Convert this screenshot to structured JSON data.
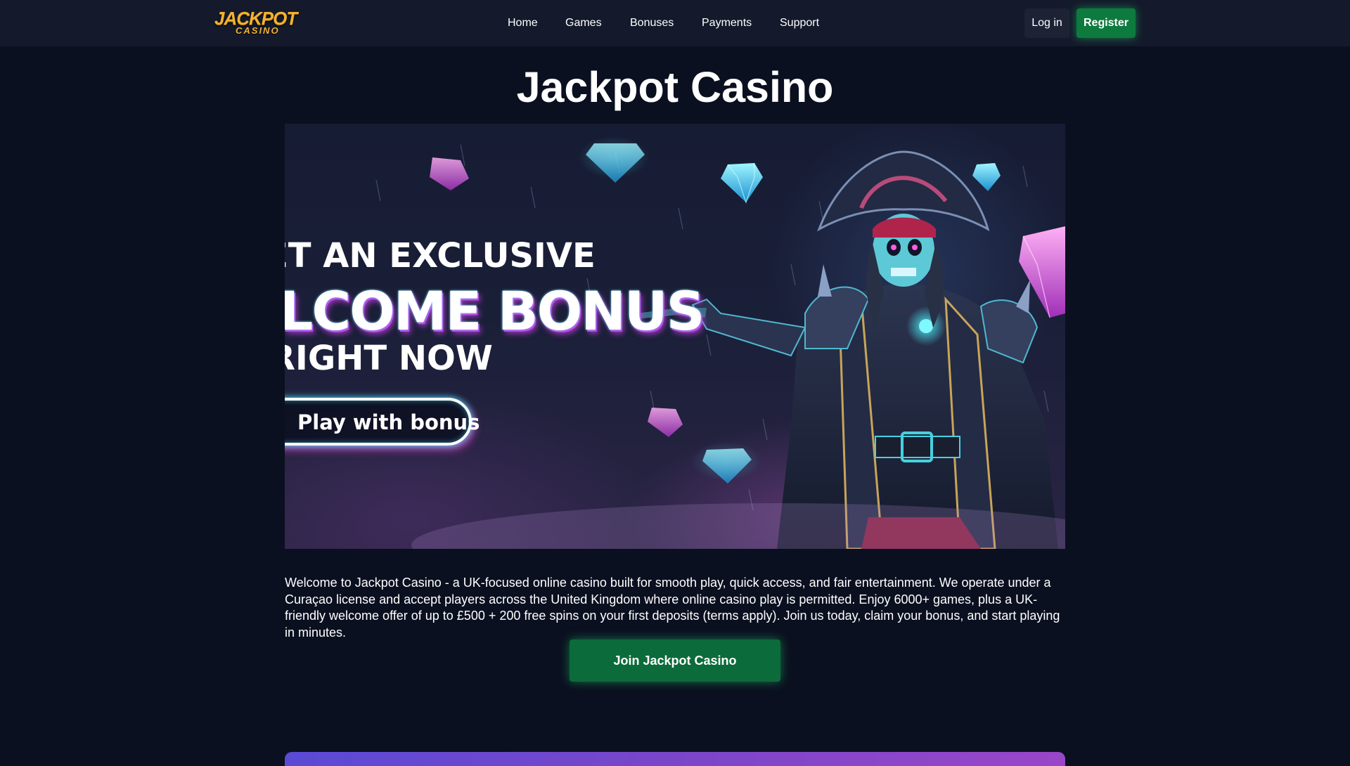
{
  "header": {
    "logo_top": "JACKPOT",
    "logo_bottom": "CASINO",
    "nav": [
      "Home",
      "Games",
      "Bonuses",
      "Payments",
      "Support"
    ],
    "login_label": "Log in",
    "register_label": "Register"
  },
  "main": {
    "title": "Jackpot Casino",
    "hero": {
      "line1": "ET AN EXCLUSIVE",
      "line2": "ELCOME BONUS",
      "line3": "RIGHT NOW",
      "cta": "Play with bonus"
    },
    "intro": "Welcome to Jackpot Casino - a UK-focused online casino built for smooth play, quick access, and fair entertainment. We operate under a Curaçao license and accept players across the United Kingdom where online casino play is permitted. Enjoy 6000+ games, plus a UK-friendly welcome offer of up to £500 + 200 free spins on your first deposits (terms apply). Join us today, claim your bonus, and start playing in minutes.",
    "join_label": "Join Jackpot Casino"
  },
  "colors": {
    "page_bg": "#0b1020",
    "header_bg": "#141a2b",
    "accent_green": "#0d7a3e",
    "logo_gold": "#f2b233",
    "neon_cyan": "#3ef0ff",
    "neon_pink": "#c13ee8"
  }
}
